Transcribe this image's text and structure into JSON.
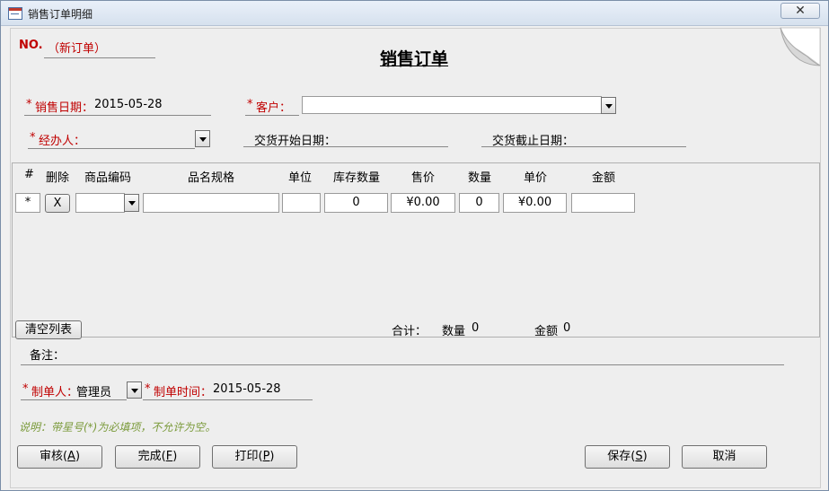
{
  "window": {
    "title": "销售订单明细",
    "close_symbol": "✕"
  },
  "header": {
    "order_no_label": "NO.",
    "order_no_value": "（新订单）",
    "form_title": "销售订单"
  },
  "fields": {
    "sale_date": {
      "star": "*",
      "label": "销售日期：",
      "value": "2015-05-28"
    },
    "customer": {
      "star": "*",
      "label": "客户：",
      "value": ""
    },
    "handler": {
      "star": "*",
      "label": "经办人：",
      "value": ""
    },
    "delivery_start": {
      "label": "交货开始日期：",
      "value": ""
    },
    "delivery_end": {
      "label": "交货截止日期：",
      "value": ""
    }
  },
  "grid": {
    "columns": [
      "#",
      "删除",
      "商品编码",
      "品名规格",
      "单位",
      "库存数量",
      "售价",
      "数量",
      "单价",
      "金额"
    ],
    "new_row": {
      "marker": "*",
      "delete": "X",
      "code": "",
      "name": "",
      "unit": "",
      "stock": "0",
      "price": "¥0.00",
      "qty": "0",
      "unit_price": "¥0.00",
      "amount": ""
    }
  },
  "totals": {
    "clear_button": "清空列表",
    "label": "合计：",
    "qty_label": "数量",
    "qty_value": "0",
    "amount_label": "金额",
    "amount_value": "0"
  },
  "remark": {
    "label": "备注："
  },
  "maker": {
    "star": "*",
    "label": "制单人：",
    "value": "管理员",
    "time_star": "*",
    "time_label": "制单时间：",
    "time_value": "2015-05-28"
  },
  "note": "说明：带星号(*)为必填项，不允许为空。",
  "buttons": {
    "audit": {
      "text": "审核(",
      "key": "A",
      "end": ")"
    },
    "finish": {
      "text": "完成(",
      "key": "F",
      "end": ")"
    },
    "print": {
      "text": "打印(",
      "key": "P",
      "end": ")"
    },
    "save": {
      "text": "保存(",
      "key": "S",
      "end": ")"
    },
    "cancel": {
      "text": "取消"
    }
  }
}
